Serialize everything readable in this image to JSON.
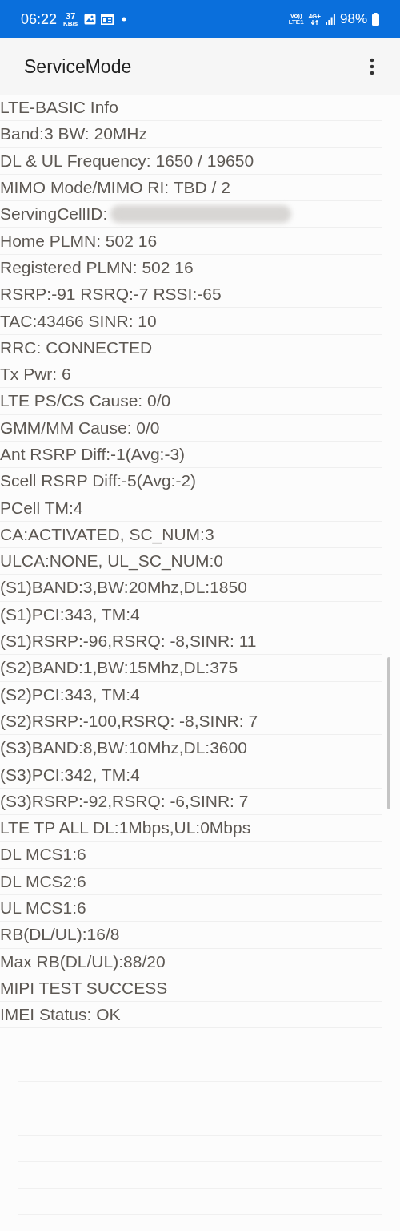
{
  "status_bar": {
    "time": "06:22",
    "speed_value": "37",
    "speed_unit": "KB/s",
    "volte_top": "Vo))",
    "volte_bottom": "LTE1",
    "network": "4G+",
    "battery": "98%"
  },
  "app_bar": {
    "title": "ServiceMode"
  },
  "rows": [
    {
      "kind": "text",
      "text": "LTE-BASIC Info"
    },
    {
      "kind": "text",
      "text": "Band:3 BW: 20MHz"
    },
    {
      "kind": "text",
      "text": "DL & UL Frequency: 1650 / 19650"
    },
    {
      "kind": "text",
      "text": "MIMO Mode/MIMO RI: TBD / 2"
    },
    {
      "kind": "redacted",
      "text": "ServingCellID:"
    },
    {
      "kind": "text",
      "text": "Home PLMN: 502 16"
    },
    {
      "kind": "text",
      "text": "Registered PLMN: 502 16"
    },
    {
      "kind": "text",
      "text": "RSRP:-91 RSRQ:-7 RSSI:-65"
    },
    {
      "kind": "text",
      "text": "TAC:43466 SINR: 10"
    },
    {
      "kind": "text",
      "text": "RRC: CONNECTED"
    },
    {
      "kind": "text",
      "text": "Tx Pwr: 6"
    },
    {
      "kind": "text",
      "text": "LTE PS/CS Cause: 0/0"
    },
    {
      "kind": "text",
      "text": "GMM/MM Cause: 0/0"
    },
    {
      "kind": "text",
      "text": "Ant RSRP Diff:-1(Avg:-3)"
    },
    {
      "kind": "text",
      "text": "Scell RSRP Diff:-5(Avg:-2)"
    },
    {
      "kind": "text",
      "text": "PCell TM:4"
    },
    {
      "kind": "text",
      "text": "CA:ACTIVATED, SC_NUM:3"
    },
    {
      "kind": "text",
      "text": "ULCA:NONE, UL_SC_NUM:0"
    },
    {
      "kind": "text",
      "text": "(S1)BAND:3,BW:20Mhz,DL:1850"
    },
    {
      "kind": "text",
      "text": "(S1)PCI:343, TM:4"
    },
    {
      "kind": "text",
      "text": "(S1)RSRP:-96,RSRQ: -8,SINR: 11"
    },
    {
      "kind": "text",
      "text": "(S2)BAND:1,BW:15Mhz,DL:375"
    },
    {
      "kind": "text",
      "text": "(S2)PCI:343, TM:4"
    },
    {
      "kind": "text",
      "text": "(S2)RSRP:-100,RSRQ: -8,SINR:  7"
    },
    {
      "kind": "text",
      "text": "(S3)BAND:8,BW:10Mhz,DL:3600"
    },
    {
      "kind": "text",
      "text": "(S3)PCI:342, TM:4"
    },
    {
      "kind": "text",
      "text": "(S3)RSRP:-92,RSRQ: -6,SINR:  7"
    },
    {
      "kind": "text",
      "text": "LTE TP ALL DL:1Mbps,UL:0Mbps"
    },
    {
      "kind": "text",
      "text": "DL MCS1:6"
    },
    {
      "kind": "text",
      "text": "DL MCS2:6"
    },
    {
      "kind": "text",
      "text": "UL MCS1:6"
    },
    {
      "kind": "text",
      "text": "RB(DL/UL):16/8"
    },
    {
      "kind": "text",
      "text": "Max RB(DL/UL):88/20"
    },
    {
      "kind": "text",
      "text": "MIPI TEST SUCCESS"
    },
    {
      "kind": "text",
      "text": "IMEI Status: OK"
    }
  ]
}
